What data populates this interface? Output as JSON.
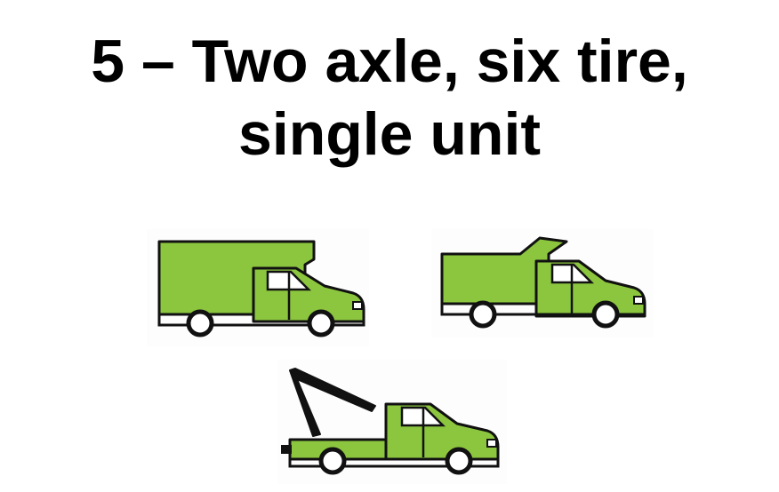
{
  "slide": {
    "title_line1": "5 – Two axle, six tire,",
    "title_line2": "single unit"
  },
  "colors": {
    "truck_green": "#8cc63f",
    "outline": "#111111",
    "wheel": "#ffffff",
    "window": "#ffffff",
    "background": "#ffffff"
  },
  "icons": [
    "box-truck-icon",
    "dump-truck-icon",
    "tow-truck-icon"
  ]
}
